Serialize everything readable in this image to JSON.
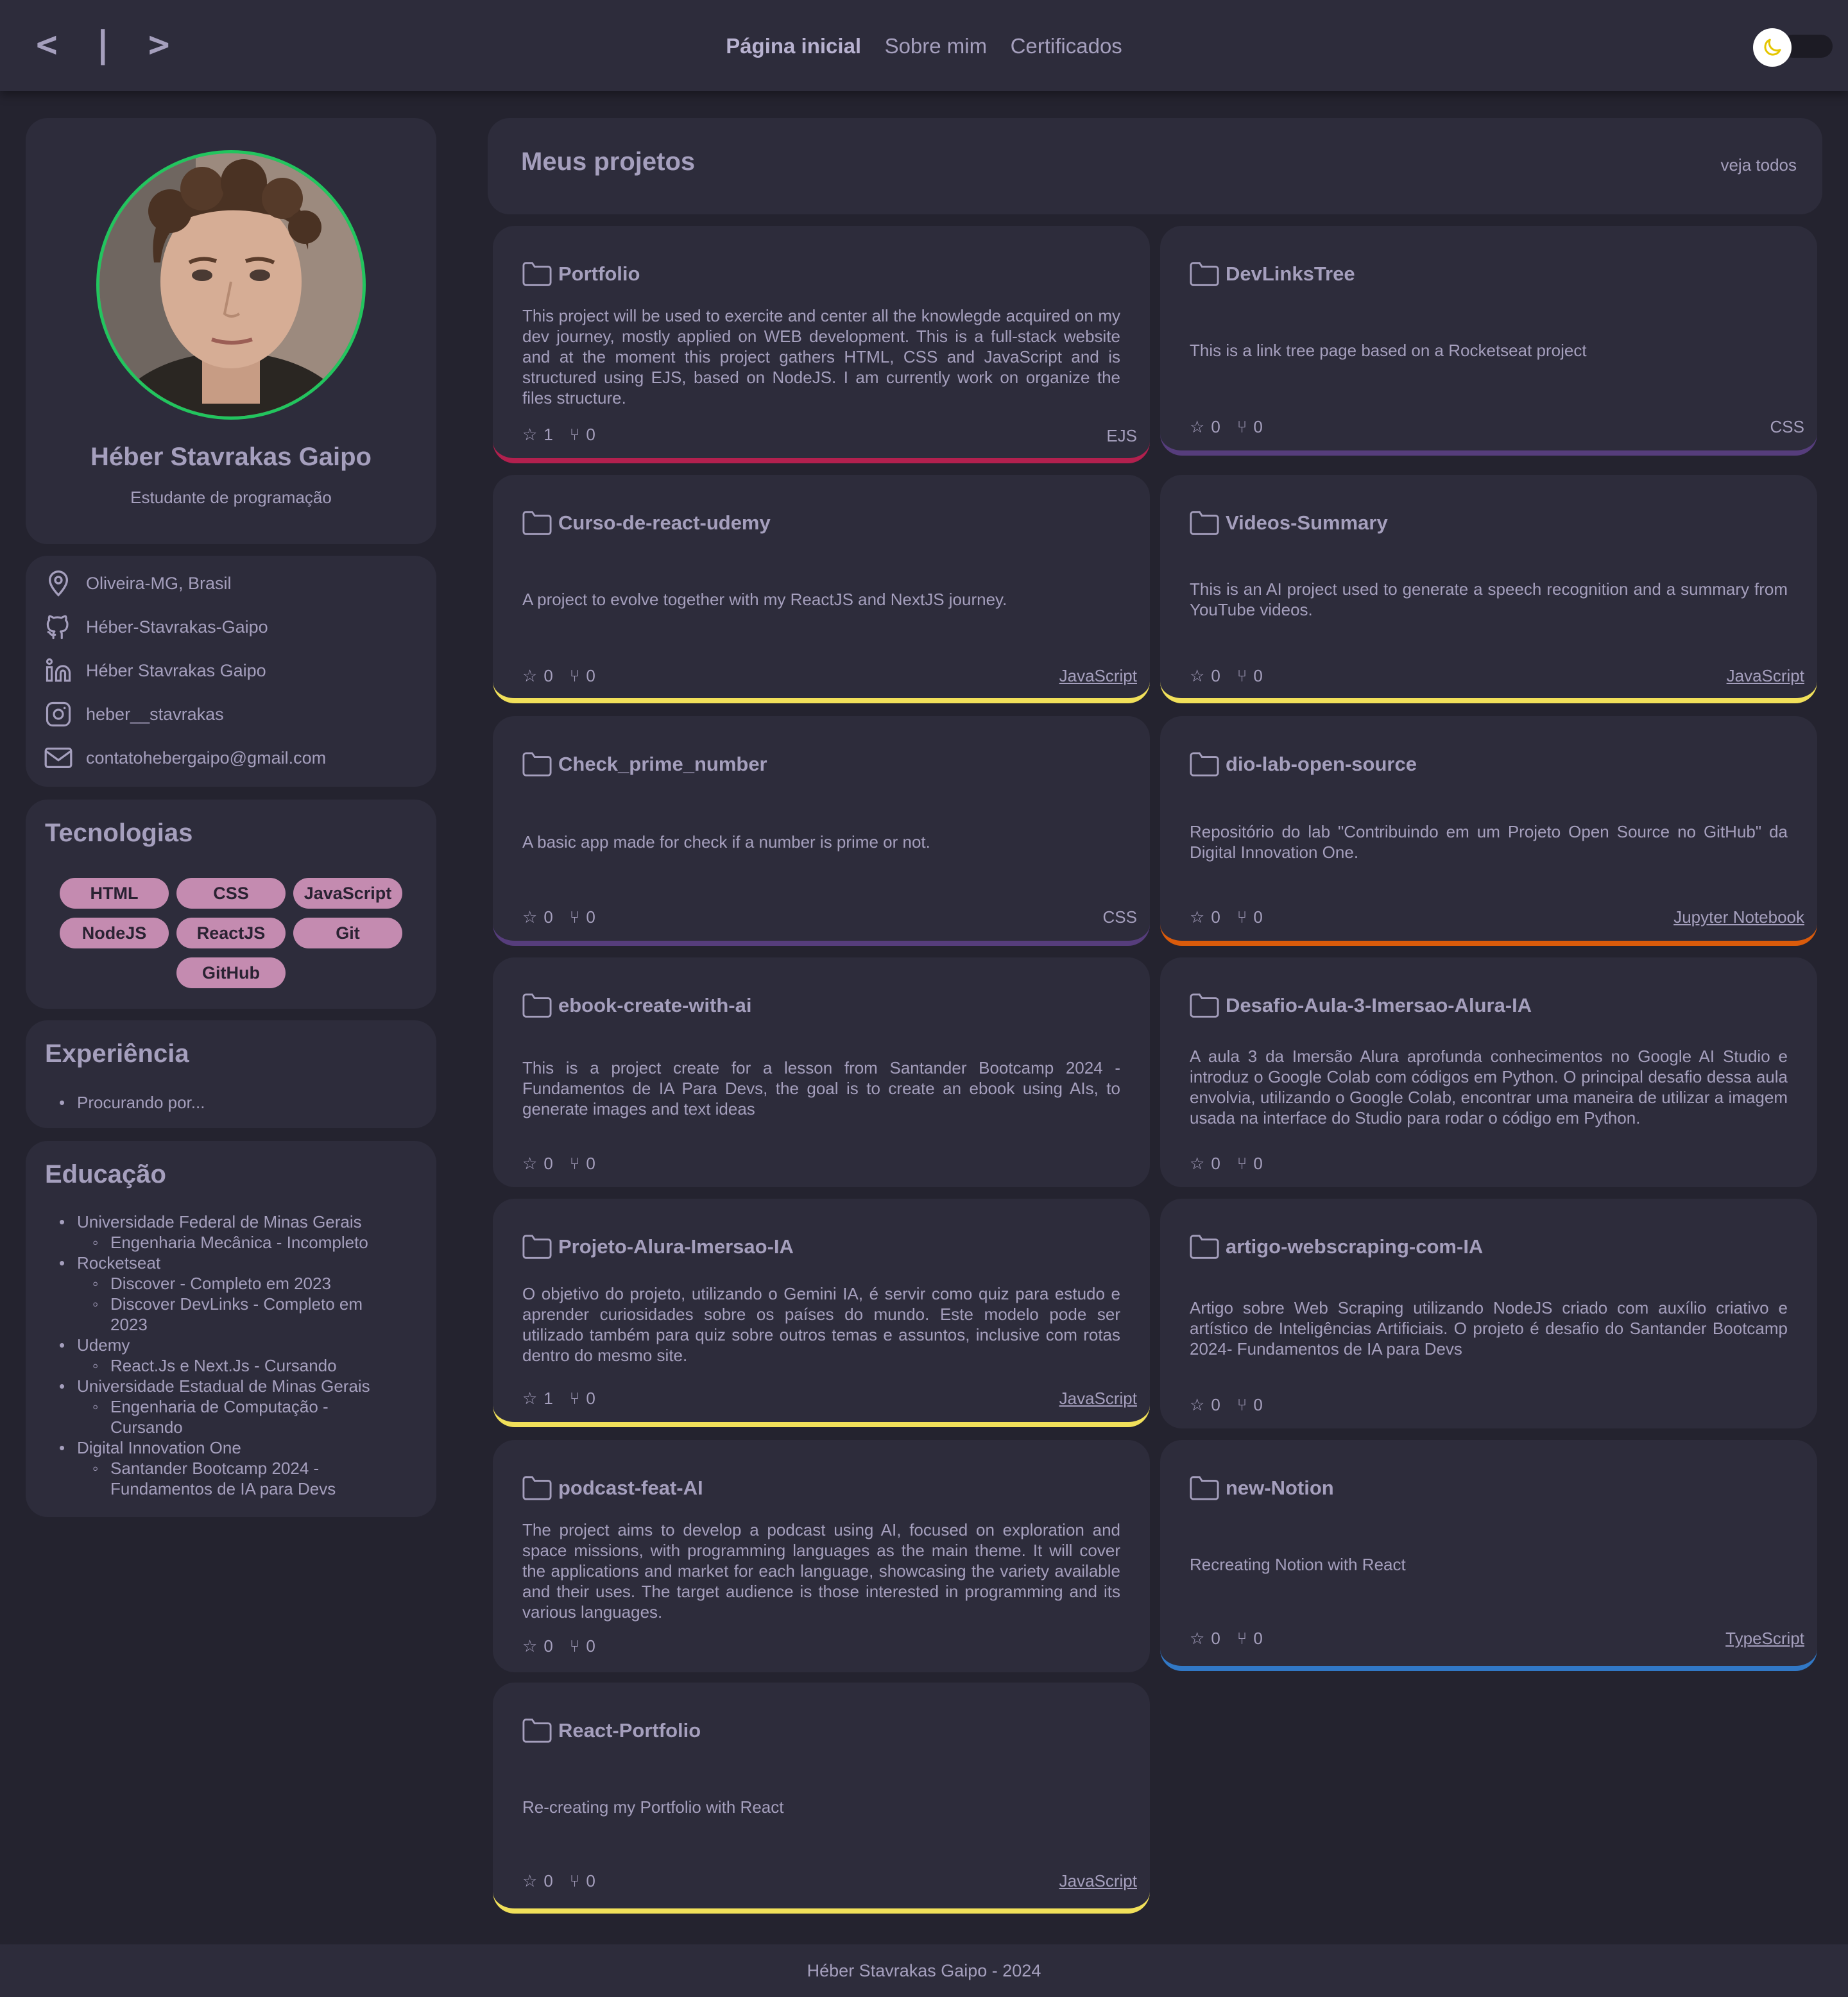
{
  "header": {
    "logo": "< | >",
    "nav": [
      "Página inicial",
      "Sobre mim",
      "Certificados"
    ],
    "theme_icon": "moon-icon"
  },
  "profile": {
    "name": "Héber Stavrakas Gaipo",
    "role": "Estudante de programação"
  },
  "contacts": [
    {
      "icon": "location-pin-icon",
      "text": "Oliveira-MG, Brasil"
    },
    {
      "icon": "github-icon",
      "text": "Héber-Stavrakas-Gaipo"
    },
    {
      "icon": "linkedin-icon",
      "text": "Héber Stavrakas Gaipo"
    },
    {
      "icon": "instagram-icon",
      "text": "heber__stavrakas"
    },
    {
      "icon": "mail-icon",
      "text": "contatohebergaipo@gmail.com"
    }
  ],
  "technologies": {
    "title": "Tecnologias",
    "tags": [
      "HTML",
      "CSS",
      "JavaScript",
      "NodeJS",
      "ReactJS",
      "Git",
      "GitHub"
    ]
  },
  "experience": {
    "title": "Experiência",
    "items": [
      "Procurando por..."
    ]
  },
  "education": {
    "title": "Educação",
    "l1_0": "Universidade Federal de Minas Gerais",
    "l2_0": "Engenharia Mecânica - Incompleto",
    "l1_1": "Rocketseat",
    "l2_1": "Discover - Completo em 2023",
    "l2_2a": "Discover DevLinks - Completo em",
    "l2_2b": "2023",
    "l1_2": "Udemy",
    "l2_3": "React.Js e Next.Js - Cursando",
    "l1_3": "Universidade Estadual de Minas Gerais",
    "l2_4a": "Engenharia de Computação -",
    "l2_4b": "Cursando",
    "l1_4": "Digital Innovation One",
    "l2_5a": "Santander Bootcamp 2024 -",
    "l2_5b": "Fundamentos de IA para Devs"
  },
  "projects_header": {
    "title": "Meus projetos",
    "see_all": "veja todos"
  },
  "projects": [
    {
      "name": "Portfolio",
      "desc": "This project will be used to exercite and center all the knowlegde acquired on my dev journey, mostly applied on WEB development. This is a full-stack website and at the moment this project gathers HTML, CSS and JavaScript and is structured using EJS, based on NodeJS. I am currently work on organize the files structure.",
      "stars": "1",
      "forks": "0",
      "lang": "EJS",
      "color": "#b2204e"
    },
    {
      "name": "DevLinksTree",
      "desc": "This is a link tree page based on a Rocketseat project",
      "stars": "0",
      "forks": "0",
      "lang": "CSS",
      "color": "#563d7c"
    },
    {
      "name": "Curso-de-react-udemy",
      "desc": "A project to evolve together with my ReactJS and NextJS journey.",
      "stars": "0",
      "forks": "0",
      "lang": "JavaScript",
      "color": "#f1e05a"
    },
    {
      "name": "Videos-Summary",
      "desc": "This is an AI project used to generate a speech recognition and a summary from YouTube videos.",
      "stars": "0",
      "forks": "0",
      "lang": "JavaScript",
      "color": "#f1e05a"
    },
    {
      "name": "Check_prime_number",
      "desc": "A basic app made for check if a number is prime or not.",
      "stars": "0",
      "forks": "0",
      "lang": "CSS",
      "color": "#563d7c"
    },
    {
      "name": "dio-lab-open-source",
      "desc": "Repositório do lab \"Contribuindo em um Projeto Open Source no GitHub\" da Digital Innovation One.",
      "stars": "0",
      "forks": "0",
      "lang": "Jupyter Notebook",
      "color": "#da5b0b"
    },
    {
      "name": "ebook-create-with-ai",
      "desc": "This is a project create for a lesson from Santander Bootcamp 2024 - Fundamentos de IA Para Devs, the goal is to create an ebook using AIs, to generate images and text ideas",
      "stars": "0",
      "forks": "0",
      "lang": "",
      "color": ""
    },
    {
      "name": "Desafio-Aula-3-Imersao-Alura-IA",
      "desc": "A aula 3 da Imersão Alura aprofunda conhecimentos no Google AI Studio e introduz o Google Colab com códigos em Python. O principal desafio dessa aula envolvia, utilizando o Google Colab, encontrar uma maneira de utilizar a imagem usada na interface do Studio para rodar o código em Python.",
      "stars": "0",
      "forks": "0",
      "lang": "",
      "color": ""
    },
    {
      "name": "Projeto-Alura-Imersao-IA",
      "desc": "O objetivo do projeto, utilizando o Gemini IA, é servir como quiz para estudo e aprender curiosidades sobre os países do mundo. Este modelo pode ser utilizado também para quiz sobre outros temas e assuntos, inclusive com rotas dentro do mesmo site.",
      "stars": "1",
      "forks": "0",
      "lang": "JavaScript",
      "color": "#f1e05a"
    },
    {
      "name": "artigo-webscraping-com-IA",
      "desc": "Artigo sobre Web Scraping utilizando NodeJS criado com auxílio criativo e artístico de Inteligências Artificiais. O projeto é desafio do Santander Bootcamp 2024- Fundamentos de IA para Devs",
      "stars": "0",
      "forks": "0",
      "lang": "",
      "color": ""
    },
    {
      "name": "podcast-feat-AI",
      "desc": "The project aims to develop a podcast using AI, focused on exploration and space missions, with programming languages as the main theme. It will cover the applications and market for each language, showcasing the variety available and their uses. The target audience is those interested in programming and its various languages.",
      "stars": "0",
      "forks": "0",
      "lang": "",
      "color": ""
    },
    {
      "name": "new-Notion",
      "desc": "Recreating Notion with React",
      "stars": "0",
      "forks": "0",
      "lang": "TypeScript",
      "color": "#3178c6"
    },
    {
      "name": "React-Portfolio",
      "desc": "Re-creating my Portfolio with React",
      "stars": "0",
      "forks": "0",
      "lang": "JavaScript",
      "color": "#f1e05a"
    }
  ],
  "footer": "Héber Stavrakas Gaipo - 2024"
}
